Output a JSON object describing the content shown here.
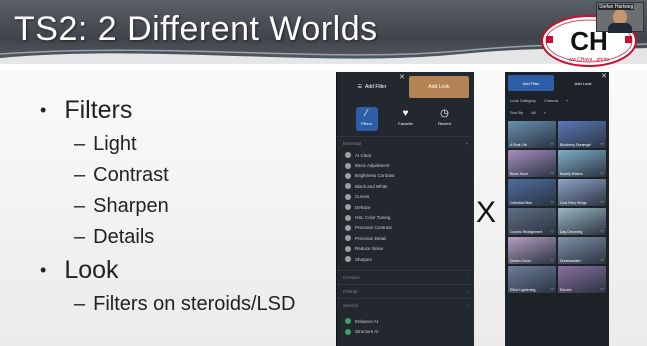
{
  "slide": {
    "title": "TS2: 2 Different Worlds",
    "bullets": [
      {
        "label": "Filters",
        "children": [
          "Light",
          "Contrast",
          "Sharpen",
          "Details"
        ]
      },
      {
        "label": "Look",
        "children": [
          "Filters on steroids/LSD"
        ]
      }
    ],
    "separator": "X",
    "logo": {
      "letters": "CH",
      "url": "ww.CHaya...photo"
    },
    "webcam_tag": "Stefan Hartweg"
  },
  "app_filters": {
    "add_filter": "Add Filter",
    "add_look": "Add Look",
    "tabs": [
      {
        "label": "Filters",
        "icon": "magic-wand-icon"
      },
      {
        "label": "Favorite",
        "icon": "heart-icon"
      },
      {
        "label": "Recent",
        "icon": "clock-icon"
      }
    ],
    "section_title": "Essential",
    "items": [
      "AI Clear",
      "Basic Adjustment",
      "Brightness Contrast",
      "Black and White",
      "Curves",
      "Dehaze",
      "HSL Color Tuning",
      "Precision Contrast",
      "Precision Detail",
      "Reduce Noise",
      "Sharpen"
    ],
    "collapsed_sections": [
      "Creative",
      "Portrait",
      "Special"
    ],
    "bottom_items": [
      "Enhance AI",
      "Structure AI"
    ]
  },
  "app_looks": {
    "tabs": [
      "Add Filter",
      "Add Look"
    ],
    "look_category_label": "Look Category",
    "look_category_value": "Cinema",
    "sort_label": "Sort By",
    "sort_value": "All",
    "looks": [
      {
        "name": "A Real Life",
        "color": "#6a8fb0"
      },
      {
        "name": "Blueberry Dreamgirl",
        "color": "#5a79b8"
      },
      {
        "name": "Blush Haze",
        "color": "#a88fc0"
      },
      {
        "name": "Bubbly Waters",
        "color": "#7fb0c8"
      },
      {
        "name": "Celestial Bites",
        "color": "#4d6ea0"
      },
      {
        "name": "Cool Fairy Wings",
        "color": "#8fa4c8"
      },
      {
        "name": "Cosmic Realignment",
        "color": "#5f6f84"
      },
      {
        "name": "Day Dreaming",
        "color": "#9cb6c4"
      },
      {
        "name": "Dream Cloud",
        "color": "#b5a0c0"
      },
      {
        "name": "Dreamwalker",
        "color": "#7f90a8"
      },
      {
        "name": "Effort Lightening",
        "color": "#6e7d9a"
      },
      {
        "name": "Electric",
        "color": "#8a6fa0"
      }
    ]
  }
}
